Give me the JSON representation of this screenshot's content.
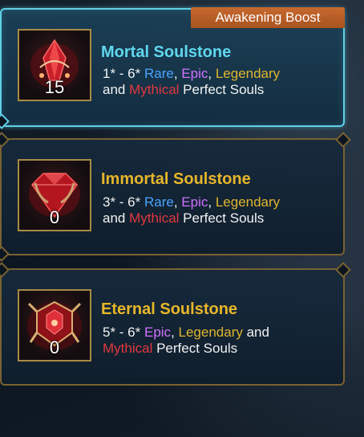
{
  "badge": "Awakening Boost",
  "cards": [
    {
      "title": "Mortal Soulstone",
      "count": "15",
      "line1_prefix": "1* - 6* ",
      "line1_parts": [
        "Rare",
        ", ",
        "Epic",
        ", ",
        "Legendary"
      ],
      "line2_parts": [
        "and ",
        "Mythical",
        " Perfect Souls"
      ],
      "icon": "mortal-soulstone-icon"
    },
    {
      "title": "Immortal Soulstone",
      "count": "0",
      "line1_prefix": "3* - 6* ",
      "line1_parts": [
        "Rare",
        ", ",
        "Epic",
        ", ",
        "Legendary"
      ],
      "line2_parts": [
        "and ",
        "Mythical",
        " Perfect Souls"
      ],
      "icon": "immortal-soulstone-icon"
    },
    {
      "title": "Eternal Soulstone",
      "count": "0",
      "line1_prefix": "5* - 6* ",
      "line1_parts": [
        "Epic",
        ", ",
        "Legendary",
        " and"
      ],
      "line2_parts": [
        "Mythical",
        " Perfect Souls"
      ],
      "icon": "eternal-soulstone-icon"
    }
  ],
  "colors": {
    "title_selected": "#5fd8ee",
    "title_default": "#e8b62a",
    "rare": "#4aa3ff",
    "epic": "#d070ff",
    "legendary": "#e0b52e",
    "mythical": "#e2383f"
  }
}
